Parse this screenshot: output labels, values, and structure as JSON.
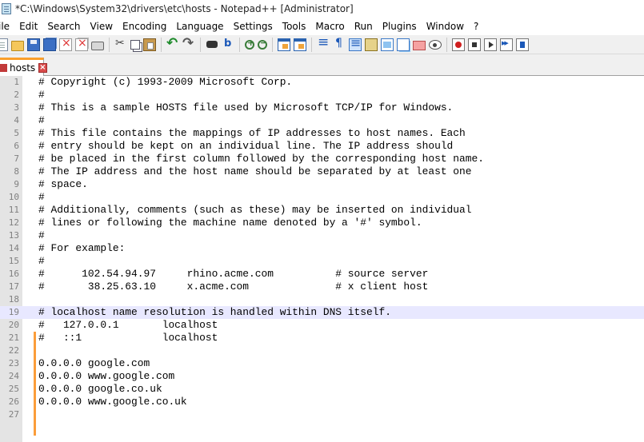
{
  "window": {
    "title": "*C:\\Windows\\System32\\drivers\\etc\\hosts - Notepad++ [Administrator]"
  },
  "menu": [
    "ile",
    "Edit",
    "Search",
    "View",
    "Encoding",
    "Language",
    "Settings",
    "Tools",
    "Macro",
    "Run",
    "Plugins",
    "Window",
    "?"
  ],
  "tabs": [
    {
      "label": "hosts",
      "active": true,
      "modified": true
    }
  ],
  "colors": {
    "active_tab_accent": "#fa9f2a",
    "current_line": "#e8e8ff",
    "change_marker": "#fb9d3a",
    "gutter": "#e4e4e4"
  },
  "editor": {
    "current_line": 19,
    "lines": [
      {
        "n": "1",
        "text": "# Copyright (c) 1993-2009 Microsoft Corp."
      },
      {
        "n": "2",
        "text": "#"
      },
      {
        "n": "3",
        "text": "# This is a sample HOSTS file used by Microsoft TCP/IP for Windows."
      },
      {
        "n": "4",
        "text": "#"
      },
      {
        "n": "5",
        "text": "# This file contains the mappings of IP addresses to host names. Each"
      },
      {
        "n": "6",
        "text": "# entry should be kept on an individual line. The IP address should"
      },
      {
        "n": "7",
        "text": "# be placed in the first column followed by the corresponding host name."
      },
      {
        "n": "8",
        "text": "# The IP address and the host name should be separated by at least one"
      },
      {
        "n": "9",
        "text": "# space."
      },
      {
        "n": "10",
        "text": "#"
      },
      {
        "n": "11",
        "text": "# Additionally, comments (such as these) may be inserted on individual"
      },
      {
        "n": "12",
        "text": "# lines or following the machine name denoted by a '#' symbol."
      },
      {
        "n": "13",
        "text": "#"
      },
      {
        "n": "14",
        "text": "# For example:"
      },
      {
        "n": "15",
        "text": "#"
      },
      {
        "n": "16",
        "text": "#      102.54.94.97     rhino.acme.com          # source server"
      },
      {
        "n": "17",
        "text": "#       38.25.63.10     x.acme.com              # x client host"
      },
      {
        "n": "18",
        "text": ""
      },
      {
        "n": "19",
        "text": "# localhost name resolution is handled within DNS itself."
      },
      {
        "n": "20",
        "text": "#   127.0.0.1       localhost"
      },
      {
        "n": "21",
        "text": "#   ::1             localhost"
      },
      {
        "n": "22",
        "text": ""
      },
      {
        "n": "23",
        "text": "0.0.0.0 google.com"
      },
      {
        "n": "24",
        "text": "0.0.0.0 www.google.com"
      },
      {
        "n": "25",
        "text": "0.0.0.0 google.co.uk"
      },
      {
        "n": "26",
        "text": "0.0.0.0 www.google.co.uk"
      },
      {
        "n": "27",
        "text": ""
      }
    ]
  }
}
